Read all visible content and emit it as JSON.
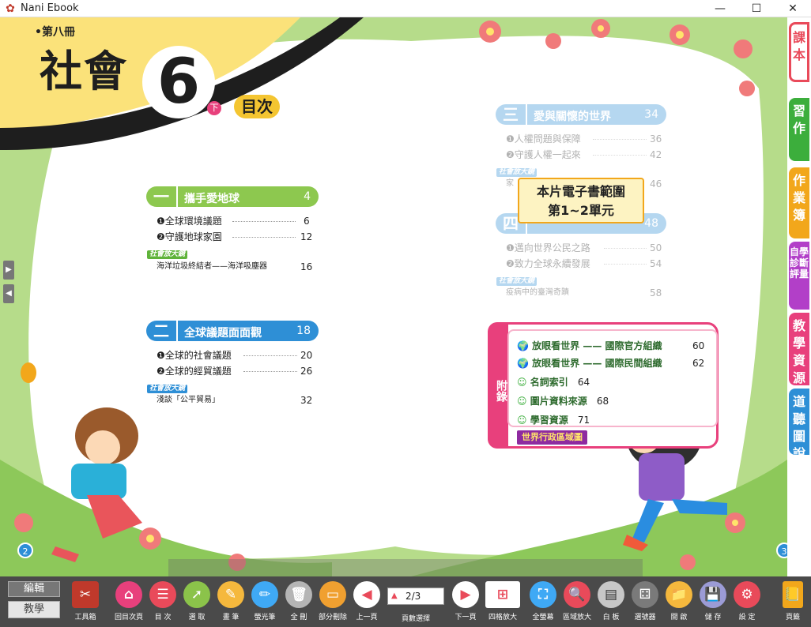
{
  "window": {
    "app_icon": "nani-logo-icon",
    "title": "Nani Ebook",
    "min_glyph": "—",
    "max_glyph": "☐",
    "close_glyph": "✕"
  },
  "cover": {
    "volume": "•第八冊",
    "subject": "社會",
    "grade": "6",
    "semester": "下",
    "toc_title": "目次"
  },
  "left_page": {
    "page_number": "2",
    "units": [
      {
        "num": "一",
        "title": "攜手愛地球",
        "page": "4",
        "lessons": [
          {
            "label": "❶全球環境議題",
            "page": "6"
          },
          {
            "label": "❷守護地球家園",
            "page": "12"
          }
        ],
        "tag": "社會放大鏡",
        "extra": {
          "label": "海洋垃圾終結者——海洋吸塵器",
          "page": "16"
        }
      },
      {
        "num": "二",
        "title": "全球議題面面觀",
        "page": "18",
        "lessons": [
          {
            "label": "❶全球的社會議題",
            "page": "20"
          },
          {
            "label": "❷全球的經貿議題",
            "page": "26"
          }
        ],
        "tag": "社會放大鏡",
        "extra": {
          "label": "淺談「公平貿易」",
          "page": "32"
        }
      }
    ]
  },
  "right_page": {
    "page_number": "3",
    "units": [
      {
        "num": "三",
        "title": "愛與關懷的世界",
        "page": "34",
        "lessons": [
          {
            "label": "❶人權問題與保障",
            "page": "36"
          },
          {
            "label": "❷守護人權一起來",
            "page": "42"
          }
        ],
        "tag": "社會放大鏡",
        "extra": {
          "label": "家",
          "page": "46"
        }
      },
      {
        "num": "四",
        "title": "",
        "page": "48",
        "lessons": [
          {
            "label": "❶邁向世界公民之路",
            "page": "50"
          },
          {
            "label": "❷致力全球永續發展",
            "page": "54"
          }
        ],
        "tag": "社會放大鏡",
        "extra": {
          "label": "疫病中的臺灣奇蹟",
          "page": "58"
        }
      }
    ],
    "notice": {
      "line1": "本片電子書範圍",
      "line2": "第1~2單元"
    },
    "appendix": {
      "label": "附錄",
      "items": [
        {
          "label": "放眼看世界 —— 國際官方組織",
          "page": "60"
        },
        {
          "label": "放眼看世界 —— 國際民間組織",
          "page": "62"
        },
        {
          "label": "名詞索引",
          "page": "64"
        },
        {
          "label": "圖片資料來源",
          "page": "68"
        },
        {
          "label": "學習資源",
          "page": "71"
        }
      ],
      "map_button": "世界行政區域圖"
    }
  },
  "side_tabs": [
    {
      "label": "課本",
      "color": "#e94a5a"
    },
    {
      "label": "習作",
      "color": "#3cae3c"
    },
    {
      "label": "作業簿",
      "color": "#f2a71b"
    },
    {
      "label": "自學診斷評量",
      "color": "#b23fc8"
    },
    {
      "label": "教學資源",
      "color": "#e8407c"
    },
    {
      "label": "道聽圖說",
      "color": "#2e8fd6"
    }
  ],
  "mode": {
    "edit": "編輯",
    "teach": "教學"
  },
  "toolbar": {
    "toolbox": "工具箱",
    "tools": [
      {
        "label": "回目次頁",
        "icon": "home-icon",
        "color": "#e8407c",
        "glyph": "⌂"
      },
      {
        "label": "目 次",
        "icon": "list-icon",
        "color": "#e94a5a",
        "glyph": "☰"
      },
      {
        "label": "選 取",
        "icon": "cursor-icon",
        "color": "#8bc34a",
        "glyph": "➚"
      },
      {
        "label": "畫 筆",
        "icon": "palette-icon",
        "color": "#f5b83d",
        "glyph": "✎"
      },
      {
        "label": "螢光筆",
        "icon": "highlighter-icon",
        "color": "#3fa9f5",
        "glyph": "✏"
      },
      {
        "label": "全 刪",
        "icon": "trash-icon",
        "color": "#b5b5b5",
        "glyph": "🗑"
      },
      {
        "label": "部分刪除",
        "icon": "eraser-icon",
        "color": "#f0a030",
        "glyph": "▭"
      },
      {
        "label": "上一頁",
        "icon": "prev-page-icon",
        "color": "#e94a5a",
        "glyph": "◀"
      },
      {
        "label": "頁數選擇",
        "icon": "page-select-icon",
        "color": "#fff",
        "glyph": "2/3"
      },
      {
        "label": "下一頁",
        "icon": "next-page-icon",
        "color": "#e94a5a",
        "glyph": "▶"
      },
      {
        "label": "四格放大",
        "icon": "four-grid-icon",
        "color": "#f4c2a1",
        "glyph": "⊞"
      },
      {
        "label": "全螢幕",
        "icon": "fullscreen-icon",
        "color": "#3fa9f5",
        "glyph": "⛶"
      },
      {
        "label": "區域放大",
        "icon": "zoom-icon",
        "color": "#e94a5a",
        "glyph": "🔍"
      },
      {
        "label": "白 板",
        "icon": "whiteboard-icon",
        "color": "#c7c7c7",
        "glyph": "▤"
      },
      {
        "label": "選號器",
        "icon": "number-picker-icon",
        "color": "#7a7a7a",
        "glyph": "⚃"
      },
      {
        "label": "開 啟",
        "icon": "folder-icon",
        "color": "#f5b83d",
        "glyph": "📁"
      },
      {
        "label": "儲 存",
        "icon": "save-icon",
        "color": "#9b9bd6",
        "glyph": "💾"
      },
      {
        "label": "設 定",
        "icon": "settings-icon",
        "color": "#e94a5a",
        "glyph": "⚙"
      }
    ],
    "page_indicator": "2/3",
    "bookmark": "頁籤"
  },
  "nav": {
    "left_up": "▶",
    "left_down": "◀"
  }
}
